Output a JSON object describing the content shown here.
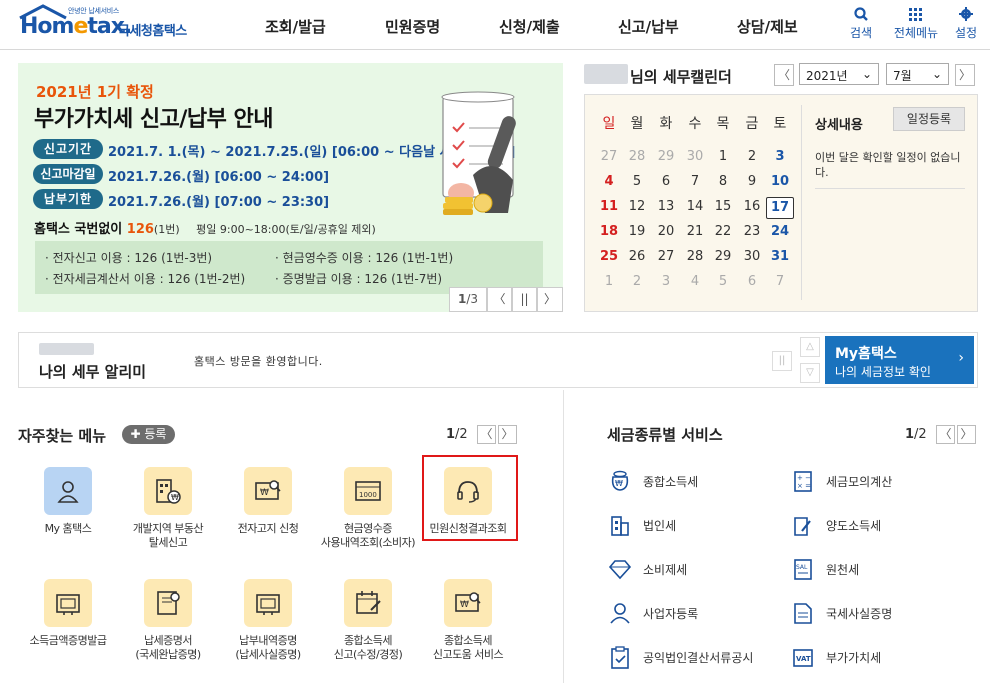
{
  "header": {
    "logo_small": "안녕안 납세서비스",
    "logo_main_a": "Hom",
    "logo_main_e": "e",
    "logo_main_b": "tax.",
    "logo_kor": "국세청홈택스",
    "gnb": [
      "조회/발급",
      "민원증명",
      "신청/제출",
      "신고/납부",
      "상담/제보"
    ],
    "util": {
      "search": "검색",
      "allmenu": "전체메뉴",
      "settings": "설정"
    }
  },
  "banner": {
    "year": "2021년 1기 확정",
    "title": "부가가치세 신고/납부 안내",
    "rows": [
      {
        "tag": "신고기간",
        "value": "2021.7. 1.(목) ~ 2021.7.25.(일) [06:00 ~ 다음날 새벽 01:00]"
      },
      {
        "tag": "신고마감일",
        "value": "2021.7.26.(월) [06:00 ~ 24:00]"
      },
      {
        "tag": "납부기한",
        "value": "2021.7.26.(월) [07:00 ~ 23:30]"
      }
    ],
    "tel_prefix": "홈택스 국번없이 ",
    "tel_num": "126",
    "tel_sub": "(1번)",
    "tel_hours": "평일 9:00~18:00(토/일/공휴일 제외)",
    "box": [
      "· 전자신고 이용 : 126 (1번-3번)",
      "· 현금영수증 이용 : 126 (1번-1번)",
      "· 전자세금계산서 이용 : 126 (1번-2번)",
      "· 증명발급 이용 : 126 (1번-7번)"
    ],
    "page_current": "1",
    "page_total": "/3",
    "prev": "〈",
    "pause": "||",
    "next": "〉"
  },
  "calendar": {
    "title_suffix": "님의 세무캘린더",
    "year_select": "2021년",
    "month_select": "7월",
    "prev": "〈",
    "next": "〉",
    "dow": [
      "일",
      "월",
      "화",
      "수",
      "목",
      "금",
      "토"
    ],
    "weeks": [
      [
        "27",
        "28",
        "29",
        "30",
        "1",
        "2",
        "3"
      ],
      [
        "4",
        "5",
        "6",
        "7",
        "8",
        "9",
        "10"
      ],
      [
        "11",
        "12",
        "13",
        "14",
        "15",
        "16",
        "17"
      ],
      [
        "18",
        "19",
        "20",
        "21",
        "22",
        "23",
        "24"
      ],
      [
        "25",
        "26",
        "27",
        "28",
        "29",
        "30",
        "31"
      ],
      [
        "1",
        "2",
        "3",
        "4",
        "5",
        "6",
        "7"
      ]
    ],
    "today": "17",
    "detail_title": "상세내용",
    "add_button": "일정등록",
    "message": "이번 달은 확인할 일정이 없습니다."
  },
  "notice": {
    "title": "나의 세무 알리미",
    "message": "홈택스 방문을 환영합니다.",
    "myhome_title": "My홈택스",
    "myhome_sub": "나의 세금정보 확인",
    "myhome_arrow": "›"
  },
  "favorites": {
    "title": "자주찾는 메뉴",
    "register": "✚ 등록",
    "page_current": "1",
    "page_total": "/2",
    "items": [
      "My 홈택스",
      "개발지역 부동산\n탈세신고",
      "전자고지 신청",
      "현금영수증\n사용내역조회(소비자)",
      "민원신청결과조회",
      "소득금액증명발급",
      "납세증명서\n(국세완납증명)",
      "납부내역증명\n(납세사실증명)",
      "종합소득세\n신고(수정/경정)",
      "종합소득세\n신고도움 서비스"
    ]
  },
  "taxservice": {
    "title": "세금종류별 서비스",
    "page_current": "1",
    "page_total": "/2",
    "left": [
      "종합소득세",
      "법인세",
      "소비제세",
      "사업자등록",
      "공익법인결산서류공시"
    ],
    "right": [
      "세금모의계산",
      "양도소득세",
      "원천세",
      "국세사실증명",
      "부가가치세"
    ]
  }
}
